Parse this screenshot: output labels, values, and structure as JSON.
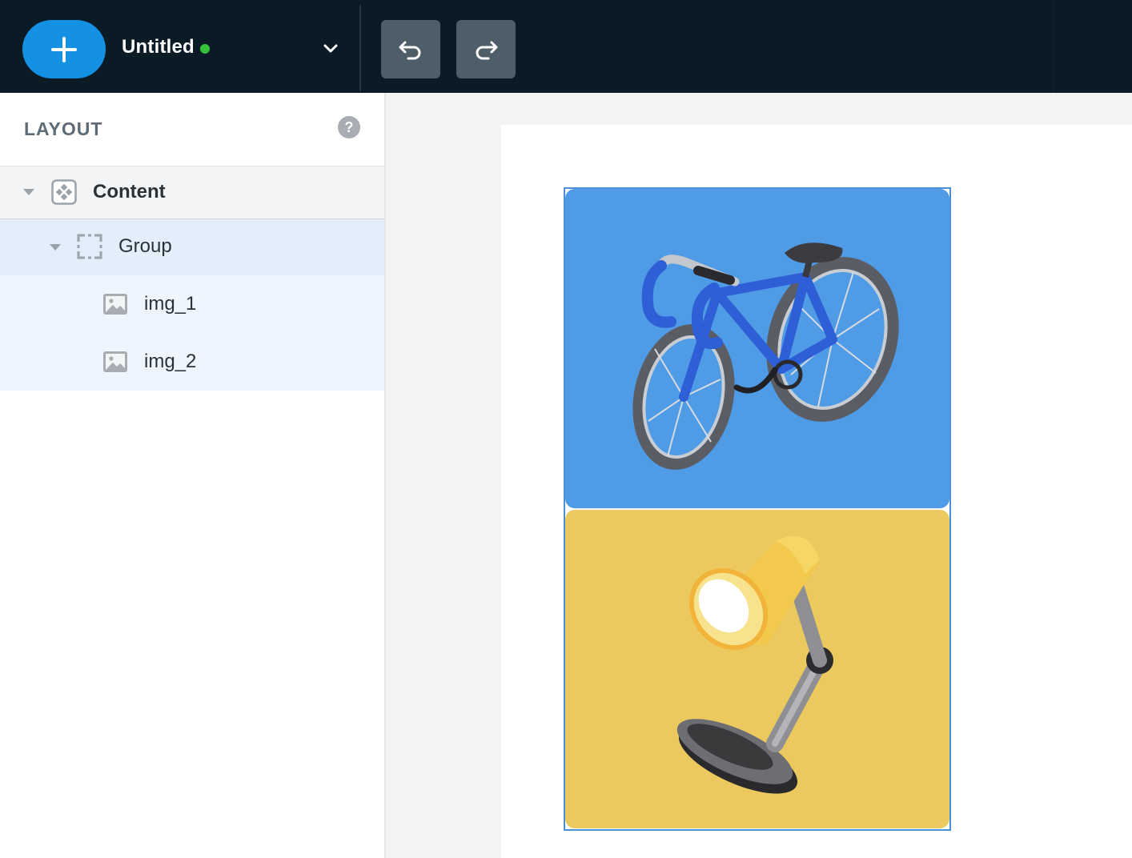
{
  "header": {
    "add_button_label": "+",
    "doc_title": "Untitled",
    "status_color": "#35c23b",
    "undo_icon": "undo-icon",
    "redo_icon": "redo-icon",
    "dropdown_icon": "chevron-down-icon"
  },
  "sidebar": {
    "title": "LAYOUT",
    "help_label": "?",
    "tree": [
      {
        "label": "Content",
        "icon": "component-icon",
        "expanded": true
      },
      {
        "label": "Group",
        "icon": "group-frame-icon",
        "expanded": true
      },
      {
        "label": "img_1",
        "icon": "image-icon"
      },
      {
        "label": "img_2",
        "icon": "image-icon"
      }
    ]
  },
  "canvas": {
    "images": [
      {
        "name": "img_1",
        "subject": "blue bicycle",
        "background": "#4f9be6"
      },
      {
        "name": "img_2",
        "subject": "yellow desk lamp",
        "background": "#ebc95f"
      }
    ]
  },
  "colors": {
    "topbar": "#0b1b26",
    "accent": "#1591e4",
    "selection": "#4a8fd9"
  }
}
